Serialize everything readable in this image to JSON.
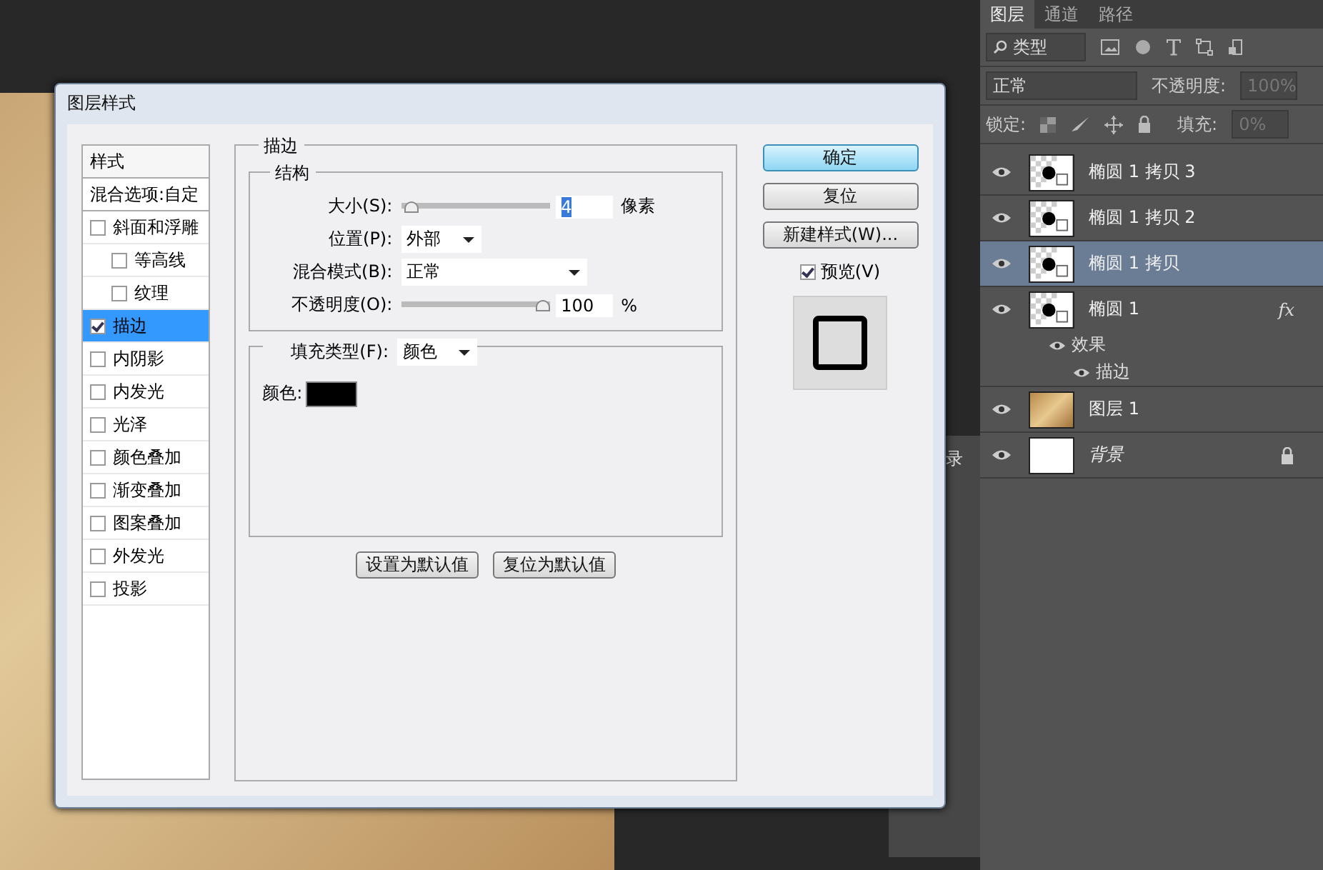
{
  "dialog": {
    "title": "图层样式",
    "styles_header": "样式",
    "blend_options": "混合选项:自定",
    "style_items": [
      {
        "label": "斜面和浮雕",
        "checked": false,
        "selected": false,
        "children": [
          {
            "label": "等高线",
            "checked": false,
            "selected": false
          },
          {
            "label": "纹理",
            "checked": false,
            "selected": false
          }
        ]
      },
      {
        "label": "描边",
        "checked": true,
        "selected": true
      },
      {
        "label": "内阴影",
        "checked": false,
        "selected": false
      },
      {
        "label": "内发光",
        "checked": false,
        "selected": false
      },
      {
        "label": "光泽",
        "checked": false,
        "selected": false
      },
      {
        "label": "颜色叠加",
        "checked": false,
        "selected": false
      },
      {
        "label": "渐变叠加",
        "checked": false,
        "selected": false
      },
      {
        "label": "图案叠加",
        "checked": false,
        "selected": false
      },
      {
        "label": "外发光",
        "checked": false,
        "selected": false
      },
      {
        "label": "投影",
        "checked": false,
        "selected": false
      }
    ],
    "stroke": {
      "title": "描边",
      "structure_title": "结构",
      "size": {
        "label": "大小(S):",
        "level": 0.02,
        "value": "4",
        "value_selected": true,
        "unit": "像素"
      },
      "position": {
        "label": "位置(P):",
        "value": "外部"
      },
      "blend_mode": {
        "label": "混合模式(B):",
        "value": "正常"
      },
      "opacity": {
        "label": "不透明度(O):",
        "level": 1,
        "value": "100",
        "unit": "%"
      },
      "fill_type": {
        "label": "填充类型(F):",
        "value": "颜色"
      },
      "color": {
        "label": "颜色:",
        "color": "#000000"
      }
    },
    "default_buttons": [
      "设置为默认值",
      "复位为默认值"
    ],
    "buttons": [
      {
        "label": "确定",
        "default": true
      },
      {
        "label": "复位",
        "default": false
      },
      {
        "label": "新建样式(W)...",
        "default": false
      }
    ],
    "preview": {
      "label": "预览(V)",
      "checked": true
    }
  },
  "history_panel": {
    "tab": "录"
  },
  "layers_panel": {
    "tabs": [
      {
        "label": "图层",
        "selected": true
      },
      {
        "label": "通道",
        "selected": false
      },
      {
        "label": "路径",
        "selected": false
      }
    ],
    "filter": "类型",
    "blend_mode": "正常",
    "opacity_label": "不透明度:",
    "opacity": "100%",
    "lock_label": "锁定:",
    "fill_label": "填充:",
    "fill": "0%",
    "layers": [
      {
        "name": "椭圆 1 拷贝 3",
        "kind": "shape",
        "selected": false,
        "locked": false
      },
      {
        "name": "椭圆 1 拷贝 2",
        "kind": "shape",
        "selected": false,
        "locked": false
      },
      {
        "name": "椭圆 1 拷贝",
        "kind": "shape",
        "selected": true,
        "locked": false
      },
      {
        "name": "椭圆 1",
        "kind": "shape",
        "selected": false,
        "fx_badge": "fx",
        "locked": false,
        "effects": {
          "label": "效果",
          "children": [
            {
              "label": "描边"
            }
          ]
        }
      },
      {
        "name": "图层 1",
        "kind": "image",
        "selected": false,
        "locked": false
      },
      {
        "name": "背景",
        "kind": "background",
        "selected": false,
        "locked": true
      }
    ]
  }
}
